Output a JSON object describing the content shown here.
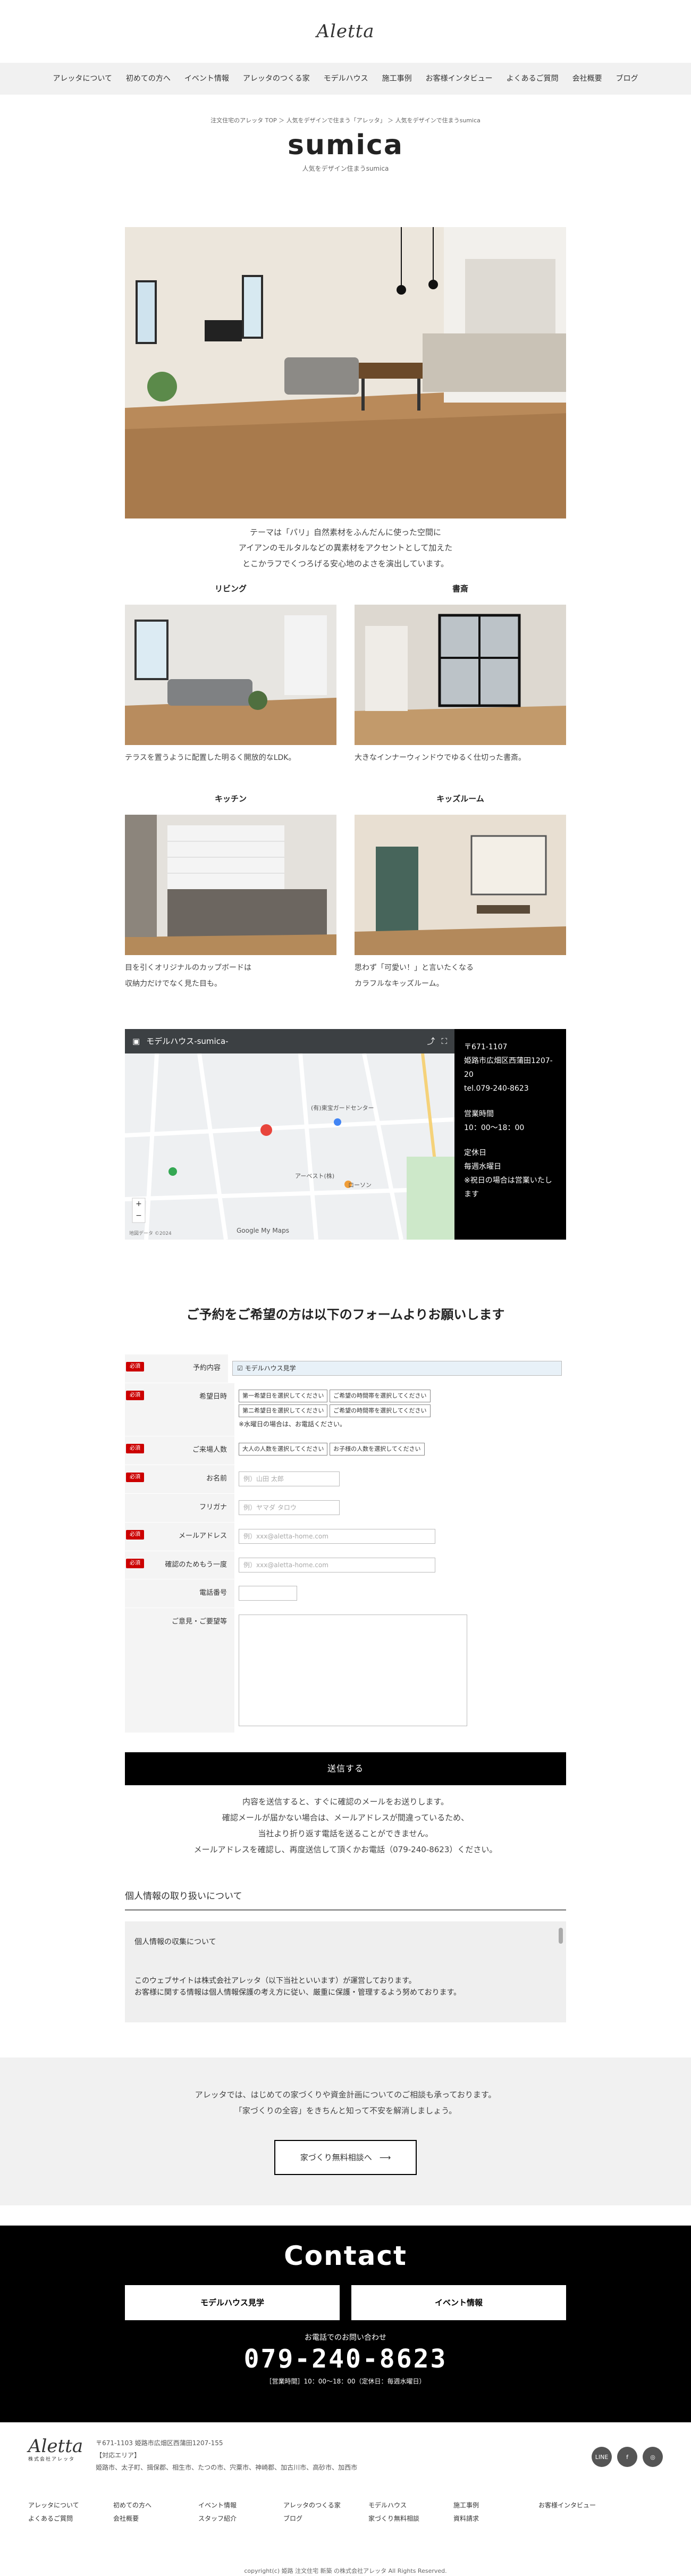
{
  "header": {
    "logo": "Aletta"
  },
  "nav": [
    "アレッタについて",
    "初めての方へ",
    "イベント情報",
    "アレッタのつくる家",
    "モデルハウス",
    "施工事例",
    "お客様インタビュー",
    "よくあるご質問",
    "会社概要",
    "ブログ"
  ],
  "page": {
    "breadcrumb": "注文住宅のアレッタ TOP ＞ 人気をデザインで住まう「アレッタ」 ＞ 人気をデザインで住まうsumica",
    "title": "sumica",
    "subtitle": "人気をデザイン住まうsumica"
  },
  "lead": [
    "テーマは「パリ」自然素材をふんだんに使った空間に",
    "アイアンのモルタルなどの異素材をアクセントとして加えた",
    "とこかラフでくつろげる安心地のよさを演出しています。"
  ],
  "rooms": [
    {
      "title": "リビング",
      "text": "テラスを置うように配置した明るく開放的なLDK。"
    },
    {
      "title": "書斎",
      "text": "大きなインナーウィンドウでゆるく仕切った書斎。"
    },
    {
      "title": "キッチン",
      "text": [
        "目を引くオリジナルのカップボードは",
        "収納力だけでなく見た目も。"
      ]
    },
    {
      "title": "キッズルーム",
      "text": [
        "思わず「可愛い！」と言いたくなる",
        "カラフルなキッズルーム。"
      ]
    }
  ],
  "map": {
    "title": "モデルハウス-sumica-",
    "label1": "(有)東宝ガードセンター",
    "label2": "アーベスト(株)",
    "label3": "ローソン",
    "google": "Google My Maps",
    "foot": "地図データ ©2024"
  },
  "info": {
    "lines": [
      "〒671-1107",
      "姫路市広畑区西蒲田1207-20",
      "tel.079-240-8623"
    ],
    "hours_label": "営業時間",
    "hours": "10：00〜18：00",
    "closed_label": "定休日",
    "closed": "毎週水曜日",
    "closed_note": "※祝日の場合は営業いたします"
  },
  "form": {
    "title": "ご予約をご希望の方は以下のフォームよりお願いします",
    "required": "必須",
    "rows": {
      "content": {
        "label": "予約内容",
        "value": "モデルハウス見学"
      },
      "date": {
        "label": "希望日時",
        "sel1": "第一希望日を選択してください",
        "sel2": "ご希望の時間帯を選択してください",
        "sel3": "第二希望日を選択してください",
        "sel4": "ご希望の時間帯を選択してください",
        "note": "※水曜日の場合は、お電話ください。"
      },
      "people": {
        "label": "ご来場人数",
        "sel1": "大人の人数を選択してください",
        "sel2": "お子様の人数を選択してください"
      },
      "name": {
        "label": "お名前",
        "ph": "例）山田 太郎"
      },
      "kana": {
        "label": "フリガナ",
        "ph": "例）ヤマダ タロウ"
      },
      "mail": {
        "label": "メールアドレス",
        "ph": "例）xxx@aletta-home.com"
      },
      "mail2": {
        "label": "確認のためもう一度",
        "ph": "例）xxx@aletta-home.com"
      },
      "tel": {
        "label": "電話番号"
      },
      "msg": {
        "label": "ご意見・ご要望等"
      }
    },
    "submit": "送信する",
    "note": [
      "内容を送信すると、すぐに確認のメールをお送りします。",
      "確認メールが届かない場合は、メールアドレスが間違っているため、",
      "当社より折り返す電話を送ることができません。",
      "メールアドレスを確認し、再度送信して頂くかお電話（079-240-8623）ください。"
    ]
  },
  "privacy": {
    "heading": "個人情報の取り扱いについて",
    "sub": "個人情報の収集について",
    "text1": "このウェブサイトは株式会社アレッタ（以下当社といいます）が運営しております。",
    "text2": "お客様に関する情報は個人情報保護の考え方に従い、厳重に保護・管理するよう努めております。"
  },
  "consult": {
    "text": [
      "アレッタでは、はじめての家づくりや資金計画についてのご相談も承っております。",
      "「家づくりの全容」をきちんと知って不安を解消しましょう。"
    ],
    "button": "家づくり無料相談へ"
  },
  "contact": {
    "title": "Contact",
    "btn1": "モデルハウス見学",
    "btn2": "イベント情報",
    "tel_label": "お電話でのお問い合わせ",
    "tel": "079-240-8623",
    "hours": "［営業時間］10：00〜18：00（定休日：毎週水曜日）"
  },
  "footer": {
    "logo": "Aletta",
    "logo_sub": "株式会社アレッタ",
    "addr": "〒671-1103 姫路市広畑区西蒲田1207-155",
    "area_label": "【対応エリア】",
    "area": "姫路市、太子町、揖保郡、相生市、たつの市、宍粟市、神崎郡、加古川市、高砂市、加西市",
    "sns": [
      "LINE",
      "f",
      "◎"
    ],
    "links": [
      "アレッタについて",
      "初めての方へ",
      "イベント情報",
      "アレッタのつくる家",
      "モデルハウス",
      "施工事例",
      "お客様インタビュー",
      "よくあるご質問",
      "会社概要",
      "スタッフ紹介",
      "ブログ",
      "家づくり無料相談",
      "資料請求"
    ],
    "copy": "copyright(c) 姫路 注文住宅 新築 の株式会社アレッタ All Rights Reserved."
  }
}
